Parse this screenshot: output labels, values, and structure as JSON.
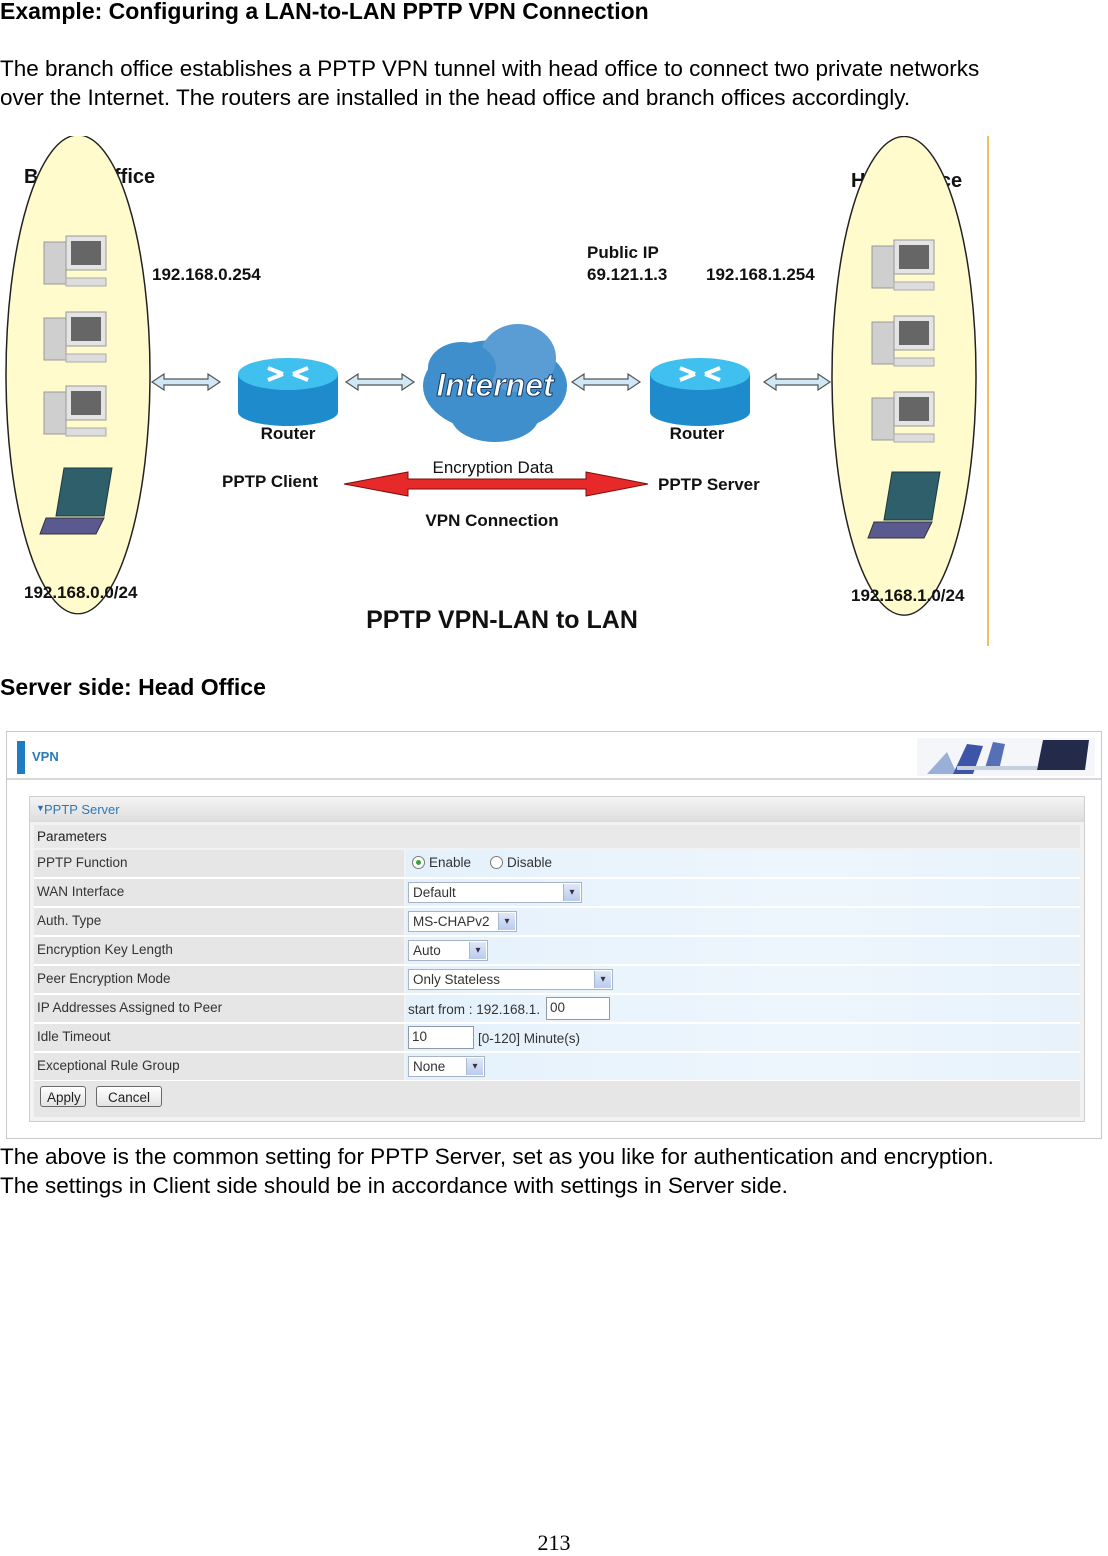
{
  "heading": "Example: Configuring a LAN-to-LAN PPTP VPN Connection",
  "intro": [
    "The branch office establishes a PPTP VPN tunnel with head office to connect two private networks",
    "over the Internet. The routers are installed in the head office and branch offices accordingly."
  ],
  "diagram": {
    "branch_title": "Branch Office",
    "head_title": "Head Office",
    "branch_router_ip": "192.168.0.254",
    "public_ip_label": "Public IP",
    "public_ip": "69.121.1.3",
    "head_router_ip": "192.168.1.254",
    "internet_label": "Internet",
    "router_left": "Router",
    "router_right": "Router",
    "pptp_client": "PPTP Client",
    "pptp_server": "PPTP Server",
    "encryption_data": "Encryption Data",
    "vpn_connection": "VPN Connection",
    "branch_subnet": "192.168.0.0/24",
    "head_subnet": "192.168.1.0/24",
    "caption": "PPTP VPN-LAN to LAN",
    "colors": {
      "office_fill": "#fffbcc",
      "router": "#29a3db",
      "cloud": "#3f8fcc",
      "vpn_arrow": "#e8292a",
      "link_arrow": "#cfe7f7"
    }
  },
  "server_heading": "Server side: Head Office",
  "ui": {
    "page_title": "VPN",
    "section_title": "PPTP Server",
    "params_label": "Parameters",
    "rows": [
      {
        "label": "PPTP Function",
        "enable_label": "Enable",
        "disable_label": "Disable",
        "selected": "Enable"
      },
      {
        "label": "WAN Interface",
        "value": "Default"
      },
      {
        "label": "Auth. Type",
        "value": "MS-CHAPv2"
      },
      {
        "label": "Encryption Key Length",
        "value": "Auto"
      },
      {
        "label": "Peer Encryption Mode",
        "value": "Only Stateless"
      },
      {
        "label": "IP Addresses Assigned to Peer",
        "prefix": "start from : 192.168.1.",
        "value": "00"
      },
      {
        "label": "Idle Timeout",
        "value": "10",
        "hint": "[0-120] Minute(s)"
      },
      {
        "label": "Exceptional Rule Group",
        "value": "None"
      }
    ],
    "apply_label": "Apply",
    "cancel_label": "Cancel",
    "accent": "#1f7cc2"
  },
  "outro": [
    "The above is the common setting for PPTP Server, set as you like for authentication and encryption.",
    "The settings in Client side should be in accordance with settings in Server side."
  ],
  "page_number": "213"
}
